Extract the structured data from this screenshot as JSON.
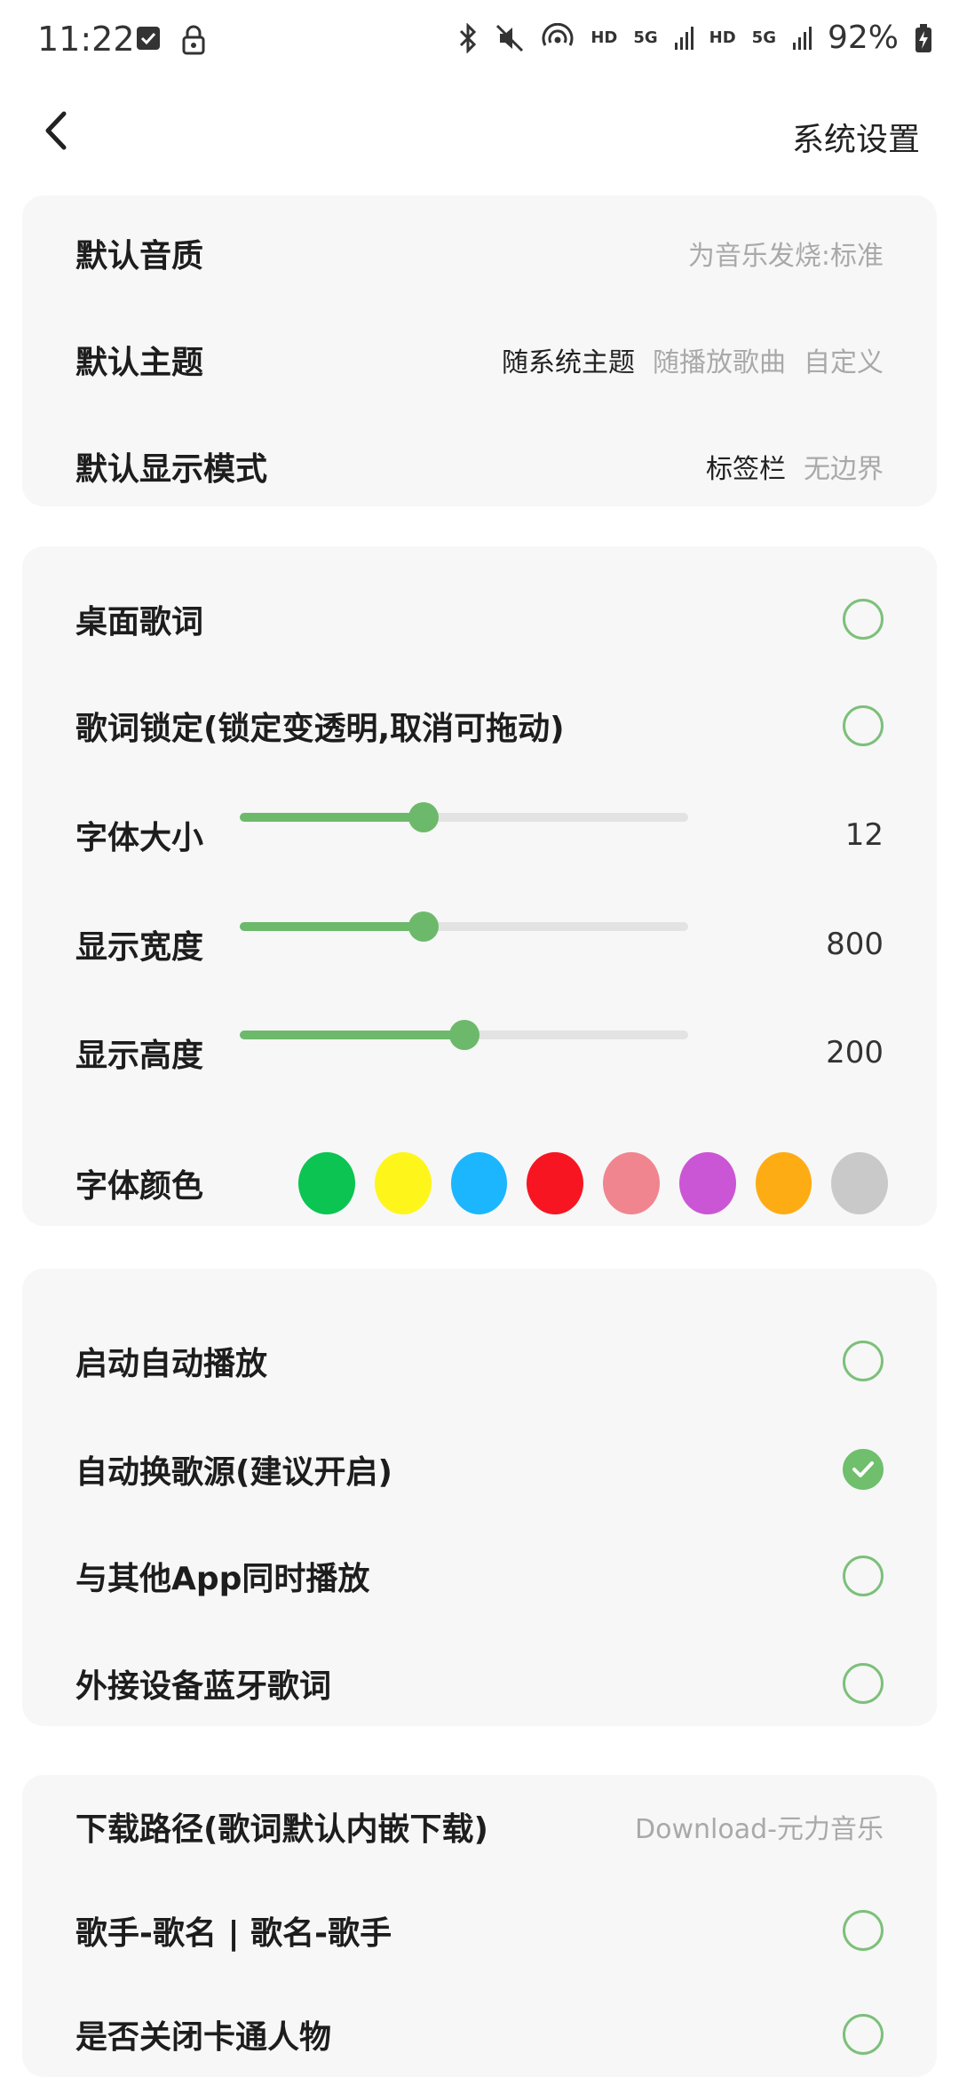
{
  "status": {
    "time": "11:22",
    "hd1": "HD",
    "net1": "5G",
    "hd2": "HD",
    "net2": "5G",
    "battery": "92%"
  },
  "header": {
    "title": "系统设置"
  },
  "card1": {
    "quality_label": "默认音质",
    "quality_value": "为音乐发烧:标准",
    "theme_label": "默认主题",
    "theme_options": [
      "随系统主题",
      "随播放歌曲",
      "自定义"
    ],
    "display_label": "默认显示模式",
    "display_options": [
      "标签栏",
      "无边界"
    ]
  },
  "card2": {
    "desktop_lyrics": "桌面歌词",
    "lyrics_lock": "歌词锁定(锁定变透明,取消可拖动)",
    "font_size_label": "字体大小",
    "font_size_value": "12",
    "font_size_level": 0.41,
    "width_label": "显示宽度",
    "width_value": "800",
    "width_level": 0.41,
    "height_label": "显示高度",
    "height_value": "200",
    "height_level": 0.5,
    "color_label": "字体颜色",
    "colors": [
      "#0cc451",
      "#fef61b",
      "#1bb6fe",
      "#f71522",
      "#f08590",
      "#cb56d5",
      "#fdac14",
      "#c9c9c9"
    ]
  },
  "card3": {
    "auto_play": "启动自动播放",
    "auto_source": "自动换歌源(建议开启)",
    "other_app": "与其他App同时播放",
    "bluetooth_lyrics": "外接设备蓝牙歌词"
  },
  "card4": {
    "download_label": "下载路径(歌词默认内嵌下载)",
    "download_value": "Download-元力音乐",
    "naming": "歌手-歌名 | 歌名-歌手",
    "cartoon": "是否关闭卡通人物"
  },
  "accent_color": "#6fbf6d"
}
